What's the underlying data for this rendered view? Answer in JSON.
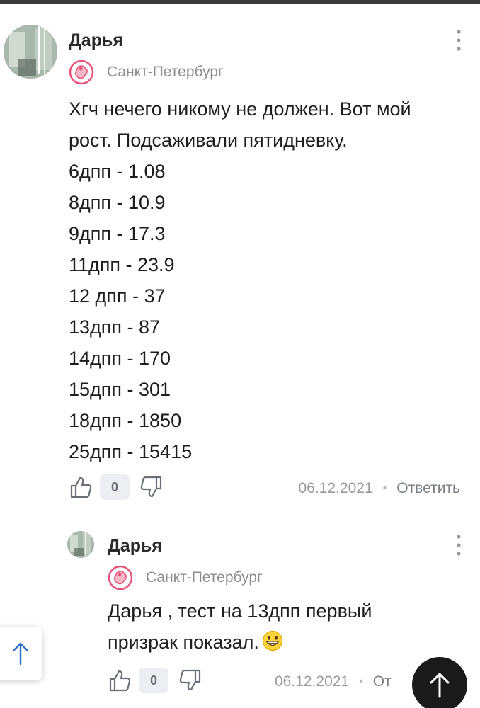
{
  "colors": {
    "text": "#1e1e1e",
    "muted": "#8d8d8d",
    "accent_pink": "#e8537a",
    "badge_bg": "#eceef2"
  },
  "comments": [
    {
      "author": "Дарья",
      "city": "Санкт-Петербург",
      "city_icon": "fetus-icon",
      "lines": [
        "Хгч нечего никому не должен. Вот мой",
        "рост. Подсаживали пятидневку.",
        "6дпп - 1.08",
        "8дпп - 10.9",
        "9дпп - 17.3",
        "11дпп - 23.9",
        "12 дпп - 37",
        "13дпп - 87",
        "14дпп - 170",
        "15дпп - 301",
        "18дпп - 1850",
        "25дпп - 15415"
      ],
      "likes": "0",
      "date": "06.12.2021",
      "separator": "•",
      "reply": "Ответить"
    },
    {
      "author": "Дарья",
      "city": "Санкт-Петербург",
      "city_icon": "fetus-icon",
      "lines": [
        "Дарья , тест на 13дпп первый",
        "призрак показал."
      ],
      "emoji": "grinning-face-emoji",
      "likes": "0",
      "date": "06.12.2021",
      "separator": "•",
      "reply": "От"
    }
  ],
  "scroll_up_icon": "arrow-up-icon"
}
